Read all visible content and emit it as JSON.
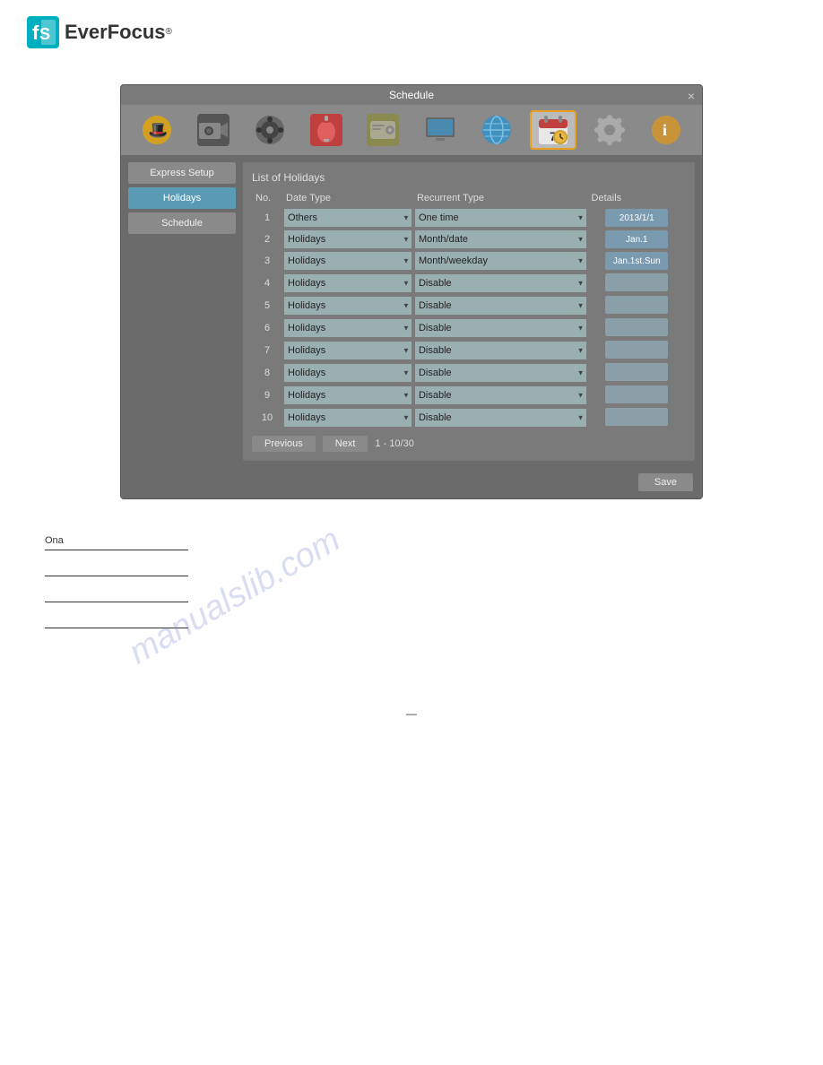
{
  "logo": {
    "text": "EverFocus",
    "reg_symbol": "®"
  },
  "window": {
    "title": "Schedule",
    "close_label": "×"
  },
  "toolbar": {
    "icons": [
      {
        "name": "magic-wand-icon",
        "label": "Express Setup",
        "active": false
      },
      {
        "name": "camera-icon",
        "label": "Camera",
        "active": false
      },
      {
        "name": "record-icon",
        "label": "Record",
        "active": false
      },
      {
        "name": "alarm-icon",
        "label": "Alarm",
        "active": false
      },
      {
        "name": "storage-icon",
        "label": "Storage",
        "active": false
      },
      {
        "name": "monitor-icon",
        "label": "Monitor",
        "active": false
      },
      {
        "name": "network-icon",
        "label": "Network",
        "active": false
      },
      {
        "name": "schedule-icon",
        "label": "Schedule",
        "active": true
      },
      {
        "name": "settings-icon",
        "label": "Settings",
        "active": false
      },
      {
        "name": "info-icon",
        "label": "Info",
        "active": false
      }
    ]
  },
  "sidebar": {
    "items": [
      {
        "label": "Express Setup",
        "active": false
      },
      {
        "label": "Holidays",
        "active": true
      },
      {
        "label": "Schedule",
        "active": false
      }
    ]
  },
  "main": {
    "section_title": "List of Holidays",
    "table": {
      "columns": [
        "No.",
        "Date Type",
        "Recurrent Type",
        "Details"
      ],
      "rows": [
        {
          "no": "1",
          "date_type": "Others",
          "recurrent_type": "One time",
          "detail": "2013/1/1"
        },
        {
          "no": "2",
          "date_type": "Holidays",
          "recurrent_type": "Month/date",
          "detail": "Jan.1"
        },
        {
          "no": "3",
          "date_type": "Holidays",
          "recurrent_type": "Month/weekday",
          "detail": "Jan.1st.Sun"
        },
        {
          "no": "4",
          "date_type": "Holidays",
          "recurrent_type": "Disable",
          "detail": ""
        },
        {
          "no": "5",
          "date_type": "Holidays",
          "recurrent_type": "Disable",
          "detail": ""
        },
        {
          "no": "6",
          "date_type": "Holidays",
          "recurrent_type": "Disable",
          "detail": ""
        },
        {
          "no": "7",
          "date_type": "Holidays",
          "recurrent_type": "Disable",
          "detail": ""
        },
        {
          "no": "8",
          "date_type": "Holidays",
          "recurrent_type": "Disable",
          "detail": ""
        },
        {
          "no": "9",
          "date_type": "Holidays",
          "recurrent_type": "Disable",
          "detail": ""
        },
        {
          "no": "10",
          "date_type": "Holidays",
          "recurrent_type": "Disable",
          "detail": ""
        }
      ],
      "date_type_options": [
        "Others",
        "Holidays"
      ],
      "recurrent_type_options": [
        "One time",
        "Month/date",
        "Month/weekday",
        "Disable"
      ]
    },
    "pagination": {
      "previous_label": "Previous",
      "next_label": "Next",
      "page_info": "1 - 10/30"
    },
    "save_label": "Save"
  },
  "watermark": "manualslib.com",
  "bottom_content": {
    "lines": [
      {
        "text": "Ona"
      },
      {
        "text": ""
      },
      {
        "text": ""
      },
      {
        "text": ""
      }
    ]
  },
  "page_number": "—"
}
